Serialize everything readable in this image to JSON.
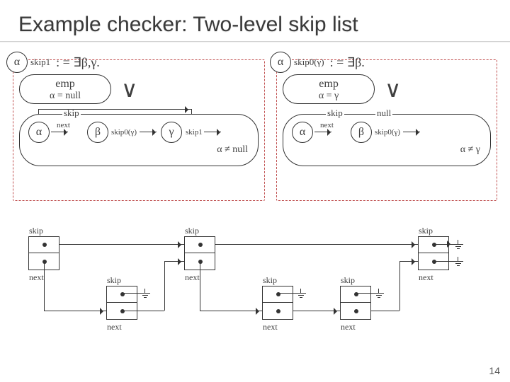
{
  "title": "Example checker: Two-level skip list",
  "greek": {
    "alpha": "α",
    "beta": "β",
    "gamma": "γ"
  },
  "left": {
    "sub": "skip1",
    "eq": ": =  ∃β,γ.",
    "emp": "emp",
    "empcond": "α = null",
    "vee": "∨",
    "skiplbl": "skip",
    "next": "next",
    "rule_mid": "skip0(γ)",
    "rule_last": "skip1",
    "cond": "α ≠ null"
  },
  "right": {
    "sub": "skip0(γ)",
    "eq": ": =  ∃β.",
    "emp": "emp",
    "empcond": "α = γ",
    "vee": "∨",
    "skiplbl": "skip",
    "nulllbl": "null",
    "next": "next",
    "rule_mid": "skip0(γ)",
    "cond": "α ≠ γ"
  },
  "cells": {
    "skip": "skip",
    "next": "next"
  },
  "page": "14"
}
